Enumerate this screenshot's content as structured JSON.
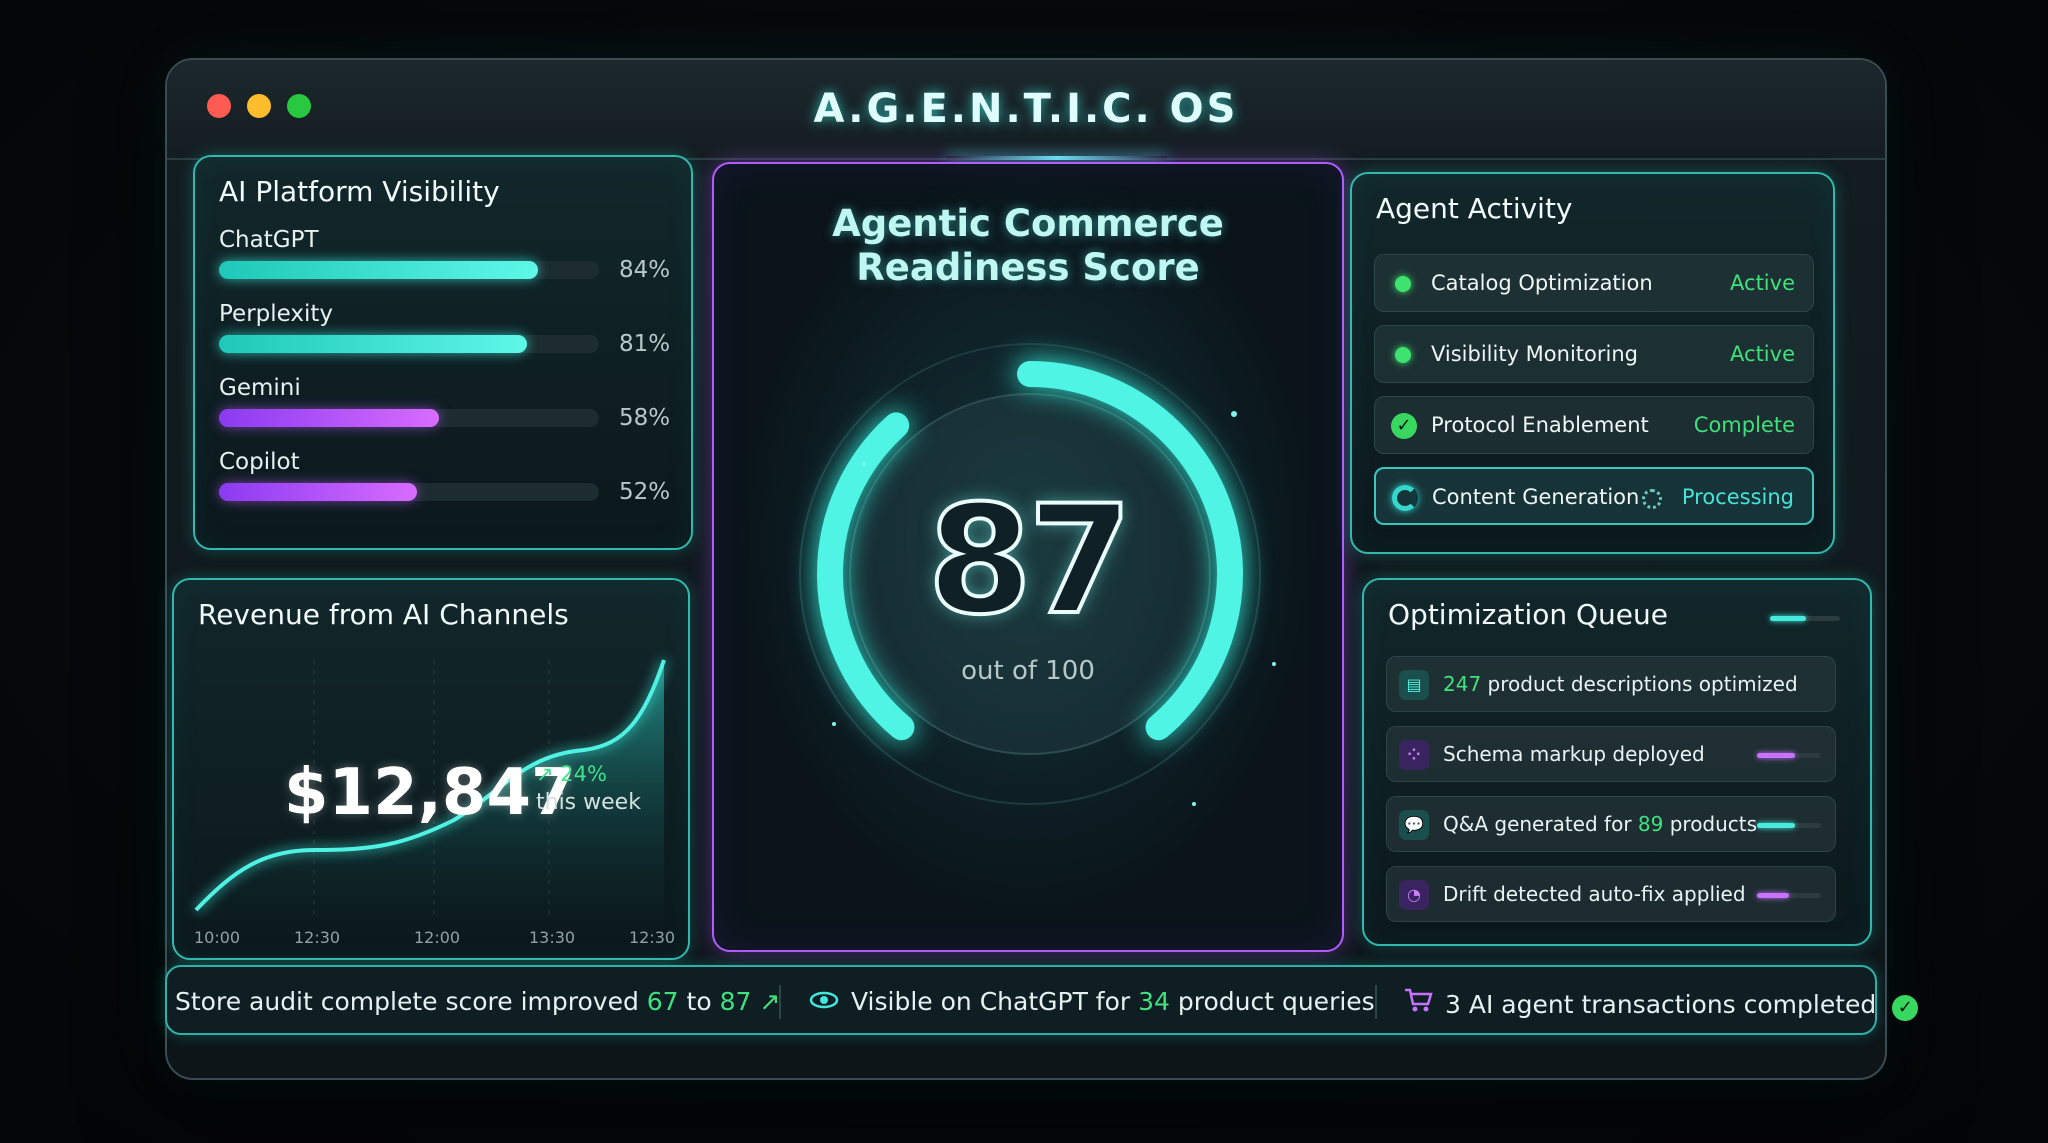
{
  "app": {
    "title": "A.G.E.N.T.I.C. OS"
  },
  "visibility": {
    "title": "AI Platform Visibility",
    "platforms": [
      {
        "name": "ChatGPT",
        "percent_label": "84%",
        "value": 84,
        "color": "teal"
      },
      {
        "name": "Perplexity",
        "percent_label": "81%",
        "value": 81,
        "color": "teal"
      },
      {
        "name": "Gemini",
        "percent_label": "58%",
        "value": 58,
        "color": "purple"
      },
      {
        "name": "Copilot",
        "percent_label": "52%",
        "value": 52,
        "color": "purple"
      }
    ]
  },
  "revenue": {
    "title": "Revenue from AI Channels",
    "amount": "$12,847",
    "change": "↗ 24%",
    "period": "this week",
    "time_ticks": [
      "10:00",
      "12:30",
      "12:00",
      "13:30",
      "12:30"
    ]
  },
  "score": {
    "title_line1": "Agentic Commerce",
    "title_line2": "Readiness Score",
    "value": "87",
    "value_num": 87,
    "max_label": "out of 100"
  },
  "agents": {
    "title": "Agent Activity",
    "items": [
      {
        "label": "Catalog Optimization",
        "status": "Active",
        "state": "active"
      },
      {
        "label": "Visibility Monitoring",
        "status": "Active",
        "state": "active"
      },
      {
        "label": "Protocol Enablement",
        "status": "Complete",
        "state": "complete"
      },
      {
        "label": "Content Generation",
        "status": "Processing",
        "state": "processing"
      }
    ]
  },
  "queue": {
    "title": "Optimization Queue",
    "items": [
      {
        "highlight": "247",
        "text": " product descriptions optimized",
        "icon": "document-icon",
        "color": "teal"
      },
      {
        "text": "Schema markup deployed",
        "icon": "grid-icon",
        "color": "purple",
        "progress": 0.6
      },
      {
        "prefix": "Q&A generated for ",
        "highlight": "89",
        "suffix": " products",
        "icon": "chat-icon",
        "color": "teal",
        "progress": 0.6
      },
      {
        "text": "Drift detected auto-fix applied",
        "icon": "pie-icon",
        "color": "purple",
        "progress": 0.5
      }
    ]
  },
  "statusbar": {
    "audit_prefix": "Store audit complete score improved ",
    "audit_from": "67",
    "audit_mid": " to ",
    "audit_to": "87",
    "audit_arrow": "↗",
    "visible_prefix": "Visible on ChatGPT for ",
    "visible_count": "34",
    "visible_suffix": " product queries",
    "transactions": "3 AI agent transactions completed"
  },
  "colors": {
    "teal": "#45ecdd",
    "purple": "#c872ff",
    "green": "#3fe27f"
  }
}
